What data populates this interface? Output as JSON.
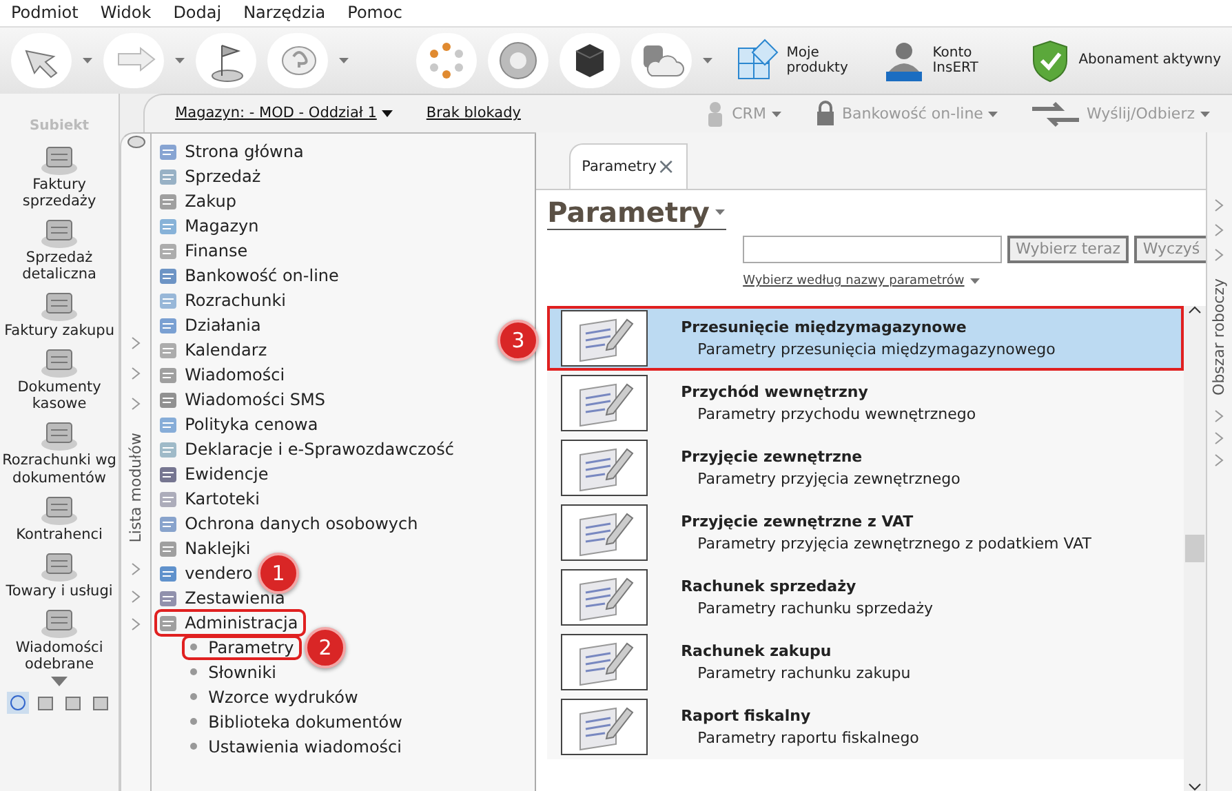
{
  "menu": [
    "Podmiot",
    "Widok",
    "Dodaj",
    "Narzędzia",
    "Pomoc"
  ],
  "account_buttons": [
    {
      "label": "Moje produkty",
      "kind": "products"
    },
    {
      "label": "Konto InsERT",
      "kind": "account"
    },
    {
      "label": "Abonament aktywny",
      "kind": "subscription"
    }
  ],
  "subbar": {
    "warehouse": "Magazyn: - MOD - Oddział 1",
    "lock": "Brak blokady",
    "actions": [
      {
        "label": "CRM",
        "kind": "crm"
      },
      {
        "label": "Bankowość on-line",
        "kind": "bank"
      },
      {
        "label": "Wyślij/Odbierz",
        "kind": "send"
      }
    ]
  },
  "nav": {
    "logo": "Subiekt",
    "items": [
      {
        "label": "Faktury sprzedaży"
      },
      {
        "label": "Sprzedaż detaliczna"
      },
      {
        "label": "Faktury zakupu"
      },
      {
        "label": "Dokumenty kasowe"
      },
      {
        "label": "Rozrachunki wg dokumentów"
      },
      {
        "label": "Kontrahenci"
      },
      {
        "label": "Towary i usługi"
      },
      {
        "label": "Wiadomości odebrane"
      }
    ]
  },
  "module_list": {
    "title": "Lista modułów",
    "items": [
      {
        "label": "Strona główna",
        "highlighted": false
      },
      {
        "label": "Sprzedaż",
        "highlighted": false
      },
      {
        "label": "Zakup",
        "highlighted": false
      },
      {
        "label": "Magazyn",
        "highlighted": false
      },
      {
        "label": "Finanse",
        "highlighted": false
      },
      {
        "label": "Bankowość on-line",
        "highlighted": false
      },
      {
        "label": "Rozrachunki",
        "highlighted": false
      },
      {
        "label": "Działania",
        "highlighted": false
      },
      {
        "label": "Kalendarz",
        "highlighted": false
      },
      {
        "label": "Wiadomości",
        "highlighted": false
      },
      {
        "label": "Wiadomości SMS",
        "highlighted": false
      },
      {
        "label": "Polityka cenowa",
        "highlighted": false
      },
      {
        "label": "Deklaracje i e-Sprawozdawczość",
        "highlighted": false
      },
      {
        "label": "Ewidencje",
        "highlighted": false
      },
      {
        "label": "Kartoteki",
        "highlighted": false
      },
      {
        "label": "Ochrona danych osobowych",
        "highlighted": false
      },
      {
        "label": "Naklejki",
        "highlighted": false
      },
      {
        "label": "vendero",
        "highlighted": false,
        "callout": "1"
      },
      {
        "label": "Zestawienia",
        "highlighted": false
      },
      {
        "label": "Administracja",
        "highlighted": true,
        "children": [
          {
            "label": "Parametry",
            "highlighted": true,
            "callout": "2"
          },
          {
            "label": "Słowniki",
            "highlighted": false
          },
          {
            "label": "Wzorce wydruków",
            "highlighted": false
          },
          {
            "label": "Biblioteka dokumentów",
            "highlighted": false
          },
          {
            "label": "Ustawienia wiadomości",
            "highlighted": false
          }
        ]
      }
    ]
  },
  "tab": {
    "label": "Parametry",
    "close": "×"
  },
  "page": {
    "title": "Parametry",
    "search_button": "Wybierz teraz",
    "clear_button": "Wyczyś",
    "filter": "Wybierz według nazwy parametrów"
  },
  "parameters": [
    {
      "title": "Przesunięcie międzymagazynowe",
      "description": "Parametry przesunięcia międzymagazynowego",
      "selected": true,
      "callout": "3"
    },
    {
      "title": "Przychód wewnętrzny",
      "description": "Parametry przychodu wewnętrznego",
      "selected": false
    },
    {
      "title": "Przyjęcie zewnętrzne",
      "description": "Parametry przyjęcia zewnętrznego",
      "selected": false
    },
    {
      "title": "Przyjęcie zewnętrzne z VAT",
      "description": "Parametry przyjęcia zewnętrznego z podatkiem VAT",
      "selected": false
    },
    {
      "title": "Rachunek sprzedaży",
      "description": "Parametry rachunku sprzedaży",
      "selected": false
    },
    {
      "title": "Rachunek zakupu",
      "description": "Parametry rachunku zakupu",
      "selected": false
    },
    {
      "title": "Raport fiskalny",
      "description": "Parametry raportu fiskalnego",
      "selected": false
    }
  ],
  "workspace": "Obszar roboczy"
}
